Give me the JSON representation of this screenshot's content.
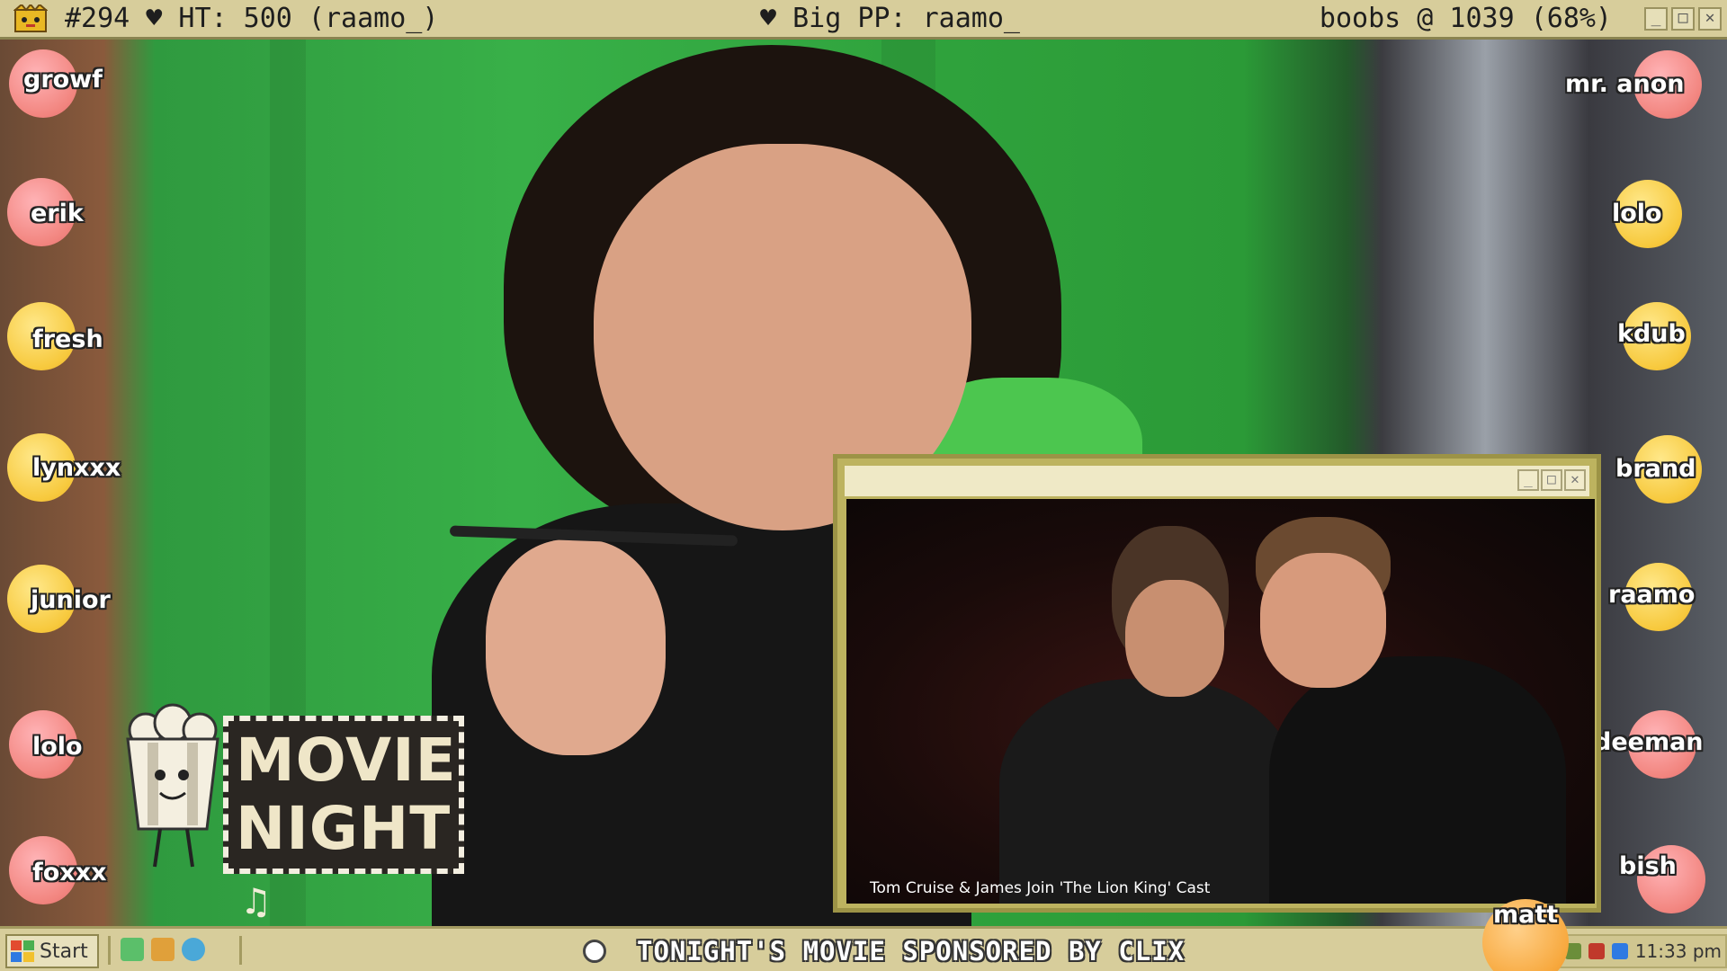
{
  "topbar": {
    "left_text": "#294 ♥ HT: 500 (raamo_)",
    "center_text": "♥ Big PP: raamo_",
    "right_text": "boobs @ 1039 (68%)",
    "buttons": [
      "_",
      "□",
      "✕"
    ]
  },
  "viewers_left": [
    {
      "name": "growf",
      "color": "pink"
    },
    {
      "name": "erik",
      "color": "pink"
    },
    {
      "name": "fresh",
      "color": "yellow"
    },
    {
      "name": "lynxxx",
      "color": "yellow"
    },
    {
      "name": "junior",
      "color": "yellow"
    },
    {
      "name": "lolo",
      "color": "pink"
    },
    {
      "name": "foxxx",
      "color": "pink"
    }
  ],
  "viewers_right": [
    {
      "name": "mr. anon",
      "color": "pink"
    },
    {
      "name": "lolo",
      "color": "yellow"
    },
    {
      "name": "kdub",
      "color": "yellow"
    },
    {
      "name": "brand",
      "color": "yellow"
    },
    {
      "name": "raamo",
      "color": "yellow"
    },
    {
      "name": "deeman",
      "color": "pink"
    },
    {
      "name": "bish",
      "color": "pink"
    },
    {
      "name": "matt",
      "color": "orange"
    }
  ],
  "movie_window": {
    "buttons": [
      "_",
      "□",
      "✕"
    ],
    "caption": "Tom Cruise & James Join 'The Lion King' Cast"
  },
  "logo": {
    "line1": "MOVIE",
    "line2": "NIGHT",
    "note": "♫"
  },
  "taskbar": {
    "start_label": "Start",
    "ticker_text": "TONIGHT'S MOVIE SPONSORED BY CLIX",
    "clock": "11:33 pm"
  },
  "colors": {
    "bar": "#d7cd9b",
    "bubble_pink": "#f2857f",
    "bubble_yellow": "#f7c93d",
    "green_screen": "#38b048"
  }
}
